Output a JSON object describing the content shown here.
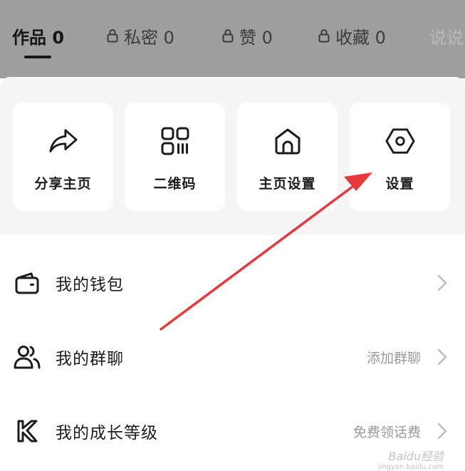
{
  "tabs": [
    {
      "label": "作品 0",
      "active": true,
      "locked": false
    },
    {
      "label": "私密 0",
      "active": false,
      "locked": true
    },
    {
      "label": "赞 0",
      "active": false,
      "locked": true
    },
    {
      "label": "收藏 0",
      "active": false,
      "locked": true
    },
    {
      "label": "说说",
      "active": false,
      "locked": false
    }
  ],
  "quick_actions": [
    {
      "label": "分享主页",
      "icon": "share-icon"
    },
    {
      "label": "二维码",
      "icon": "qr-code-icon"
    },
    {
      "label": "主页设置",
      "icon": "home-icon"
    },
    {
      "label": "设置",
      "icon": "settings-hexagon-icon"
    }
  ],
  "menu": [
    {
      "label": "我的钱包",
      "value": "",
      "icon": "wallet-icon"
    },
    {
      "label": "我的群聊",
      "value": "添加群聊",
      "icon": "group-users-icon"
    },
    {
      "label": "我的成长等级",
      "value": "免费领话费",
      "icon": "growth-level-k-icon"
    }
  ],
  "watermark": {
    "brand": "Baidu经验",
    "url": "jingyan.baidu.com"
  },
  "colors": {
    "annotation_arrow": "#e8383b",
    "dim_overlay": "#9e9e9e"
  }
}
